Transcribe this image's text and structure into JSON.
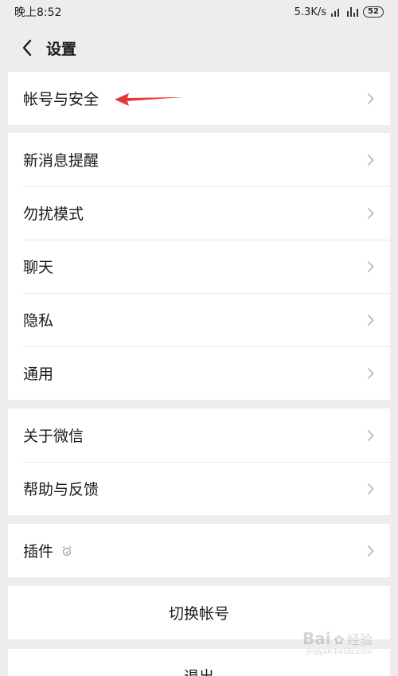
{
  "status_bar": {
    "time": "晚上8:52",
    "network_speed": "5.3K/s",
    "battery": "52"
  },
  "nav": {
    "title": "设置",
    "back_icon": "chevron-left-icon"
  },
  "groups": [
    {
      "items": [
        {
          "label": "帐号与安全"
        }
      ]
    },
    {
      "items": [
        {
          "label": "新消息提醒"
        },
        {
          "label": "勿扰模式"
        },
        {
          "label": "聊天"
        },
        {
          "label": "隐私"
        },
        {
          "label": "通用"
        }
      ]
    },
    {
      "items": [
        {
          "label": "关于微信"
        },
        {
          "label": "帮助与反馈"
        }
      ]
    },
    {
      "items": [
        {
          "label": "插件"
        }
      ]
    }
  ],
  "actions": {
    "switch_account": "切换帐号",
    "logout": "退出"
  },
  "watermark": {
    "brand": "Bai",
    "suffix": "经验",
    "url": "jingyan.baidu.com"
  },
  "colors": {
    "background": "#ededed",
    "card": "#ffffff",
    "annotation_arrow": "#e53935"
  }
}
